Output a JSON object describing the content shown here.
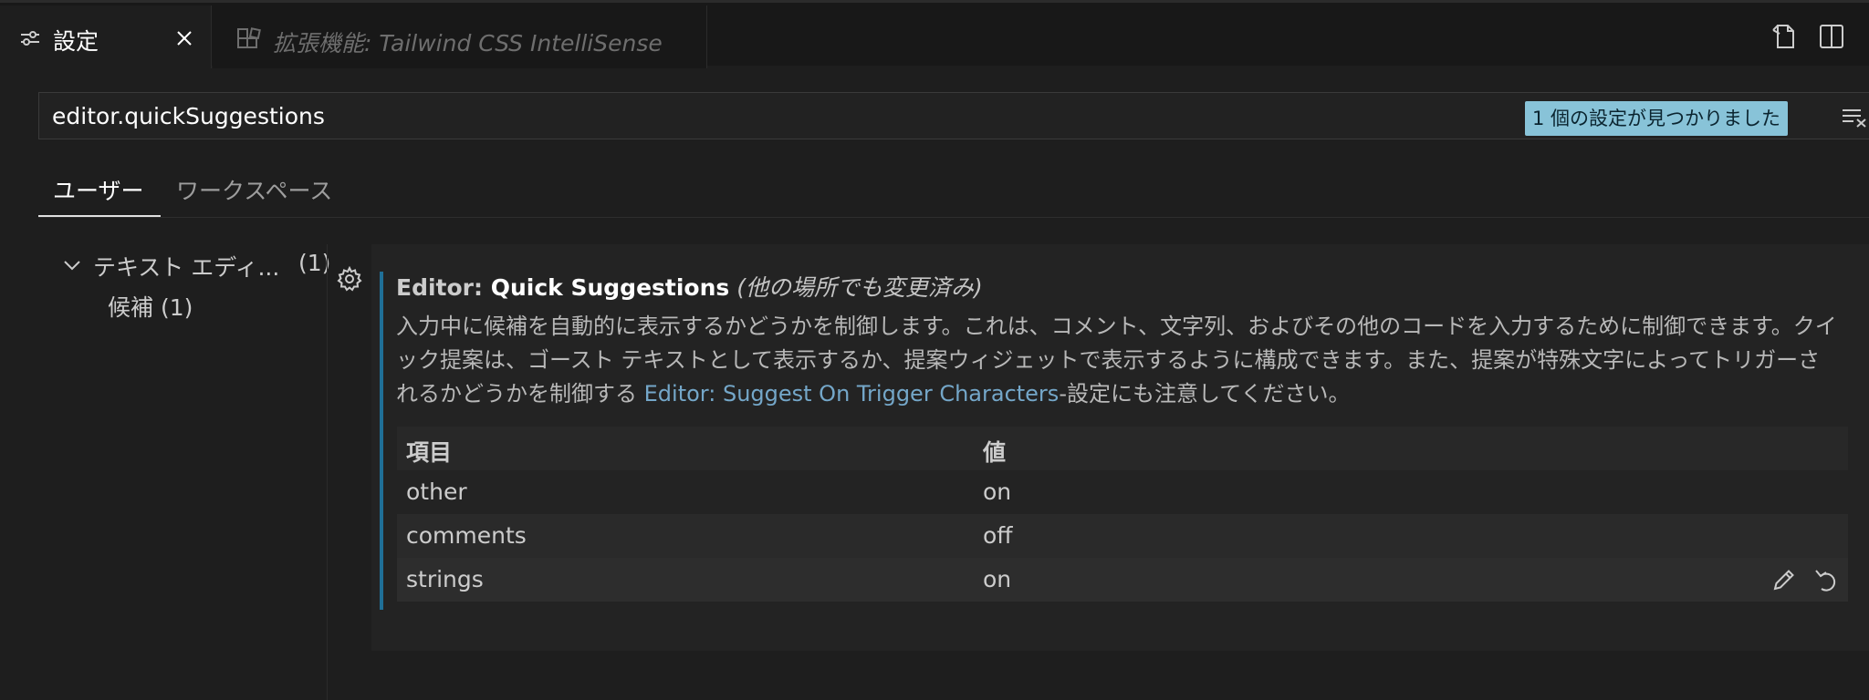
{
  "tabs": [
    {
      "label": "設定",
      "icon": "settings-sliders-icon",
      "active": true
    },
    {
      "label": "拡張機能: Tailwind CSS IntelliSense",
      "icon": "extensions-icon",
      "active": false
    }
  ],
  "search": {
    "value": "editor.quickSuggestions",
    "result_badge": "1 個の設定が見つかりました"
  },
  "scope_tabs": [
    "ユーザー",
    "ワークスペース"
  ],
  "toc": {
    "group_label": "テキスト エディ...",
    "group_count": "(1)",
    "item_label": "候補 (1)"
  },
  "setting": {
    "category": "Editor: ",
    "name": "Quick Suggestions",
    "modified_note": "(他の場所でも変更済み)",
    "desc_part1": "入力中に候補を自動的に表示するかどうかを制御します。これは、コメント、文字列、およびその他のコードを入力するために制御できます。クイック提案は、ゴースト テキストとして表示するか、提案ウィジェットで表示するように構成できます。また、提案が特殊文字によってトリガーされるかどうかを制御する ",
    "desc_link": "Editor: Suggest On Trigger Characters",
    "desc_part2": "-設定にも注意してください。",
    "table": {
      "headers": [
        "項目",
        "値"
      ],
      "rows": [
        {
          "key": "other",
          "value": "on"
        },
        {
          "key": "comments",
          "value": "off"
        },
        {
          "key": "strings",
          "value": "on"
        }
      ]
    }
  },
  "colors": {
    "badge_bg": "#88c3d8",
    "focus_bar": "#1f6f97",
    "link": "#74a7c9"
  }
}
